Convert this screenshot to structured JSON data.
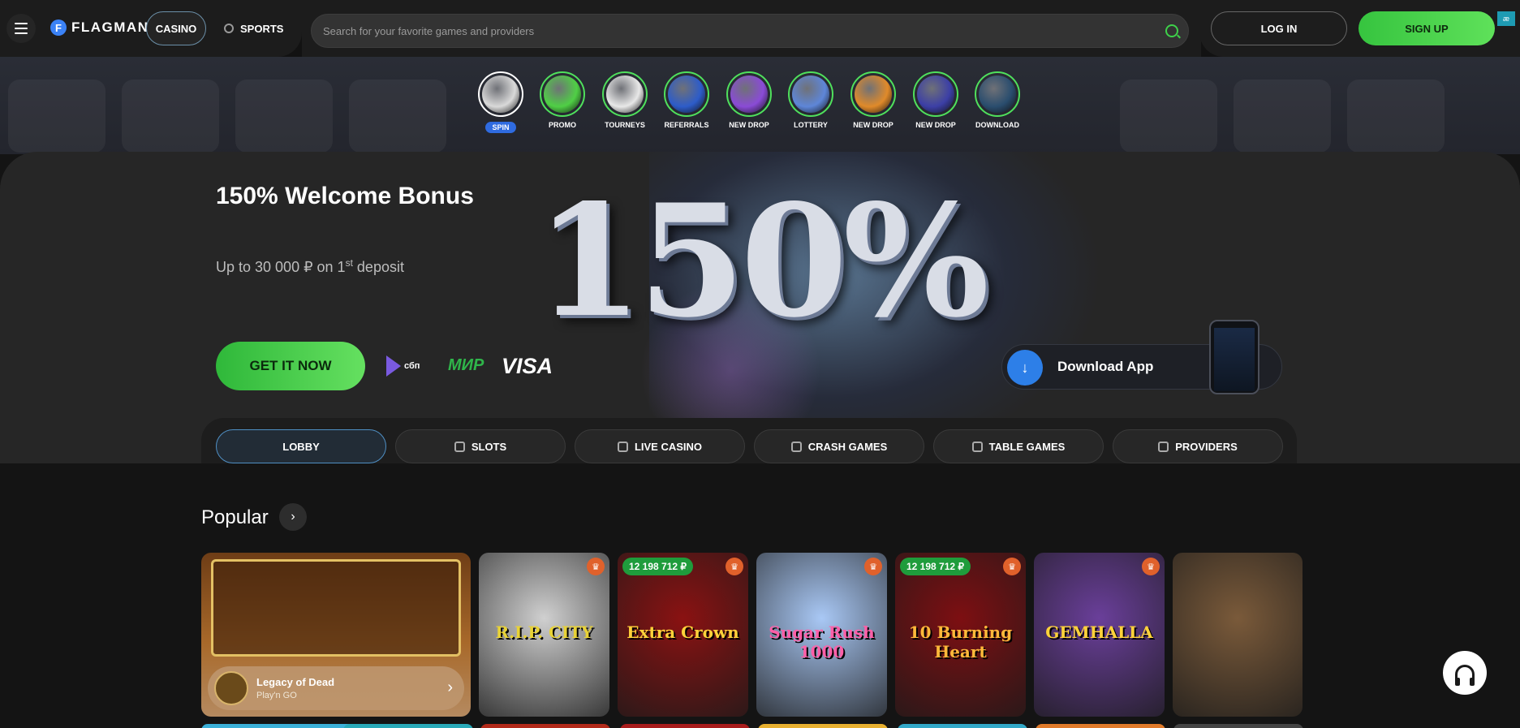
{
  "header": {
    "logo_text": "FLAGMAN",
    "tabs": [
      {
        "label": "CASINO",
        "active": true
      },
      {
        "label": "SPORTS",
        "active": false
      }
    ],
    "search_placeholder": "Search for your favorite games and providers",
    "login_label": "LOG IN",
    "signup_label": "SIGN UP",
    "language_badge": "æ"
  },
  "stories": [
    {
      "label": "SPIN",
      "highlight": true,
      "color": "#d9d9d9"
    },
    {
      "label": "PROMO",
      "highlight": false,
      "color": "#4fcf45"
    },
    {
      "label": "TOURNEYS",
      "highlight": false,
      "color": "#e8e8e8"
    },
    {
      "label": "REFERRALS",
      "highlight": false,
      "color": "#2d5cc9"
    },
    {
      "label": "NEW DROP",
      "highlight": false,
      "color": "#8a4bd6"
    },
    {
      "label": "LOTTERY",
      "highlight": false,
      "color": "#5e86d8"
    },
    {
      "label": "NEW DROP",
      "highlight": false,
      "color": "#e08a2a"
    },
    {
      "label": "NEW DROP",
      "highlight": false,
      "color": "#3c3fa6"
    },
    {
      "label": "DOWNLOAD",
      "highlight": false,
      "color": "#2a4d6e"
    }
  ],
  "banner": {
    "title": "150% Welcome Bonus",
    "subtitle_main": "Up to 30 000 ₽ on 1",
    "subtitle_sup": "st",
    "subtitle_end": " deposit",
    "big_text": "150%",
    "cta_label": "GET IT NOW",
    "payments": {
      "sbp": "сбп",
      "mir": "МИР",
      "visa": "VISA"
    },
    "download_label": "Download App"
  },
  "categories": [
    {
      "label": "LOBBY",
      "active": true,
      "icon": ""
    },
    {
      "label": "SLOTS",
      "active": false,
      "icon": "cherry-icon"
    },
    {
      "label": "LIVE CASINO",
      "active": false,
      "icon": "live-icon"
    },
    {
      "label": "CRASH GAMES",
      "active": false,
      "icon": "chart-icon"
    },
    {
      "label": "TABLE GAMES",
      "active": false,
      "icon": "dice-icon"
    },
    {
      "label": "PROVIDERS",
      "active": false,
      "icon": "grid-icon"
    }
  ],
  "popular": {
    "title": "Popular",
    "featured": {
      "name": "Legacy of Dead",
      "provider": "Play'n GO"
    },
    "games": [
      {
        "name": "R.I.P. CITY",
        "jackpot": "",
        "trophy": true,
        "bg": "#d0d0d0",
        "text_color": "#e8d236"
      },
      {
        "name": "Extra Crown",
        "jackpot": "12 198 712 ₽",
        "trophy": true,
        "bg": "#8a1212",
        "text_color": "#ffd23a"
      },
      {
        "name": "Sugar Rush 1000",
        "jackpot": "",
        "trophy": true,
        "bg": "#a9c8f5",
        "text_color": "#ff5fa8"
      },
      {
        "name": "10 Burning Heart",
        "jackpot": "12 198 712 ₽",
        "trophy": true,
        "bg": "#7d0f12",
        "text_color": "#ffb93a"
      },
      {
        "name": "GEMHALLA",
        "jackpot": "",
        "trophy": true,
        "bg": "#6a3f9a",
        "text_color": "#ffd23a"
      },
      {
        "name": "",
        "jackpot": "",
        "trophy": false,
        "bg": "#7a5a3a",
        "text_color": "#ffffff"
      }
    ]
  }
}
